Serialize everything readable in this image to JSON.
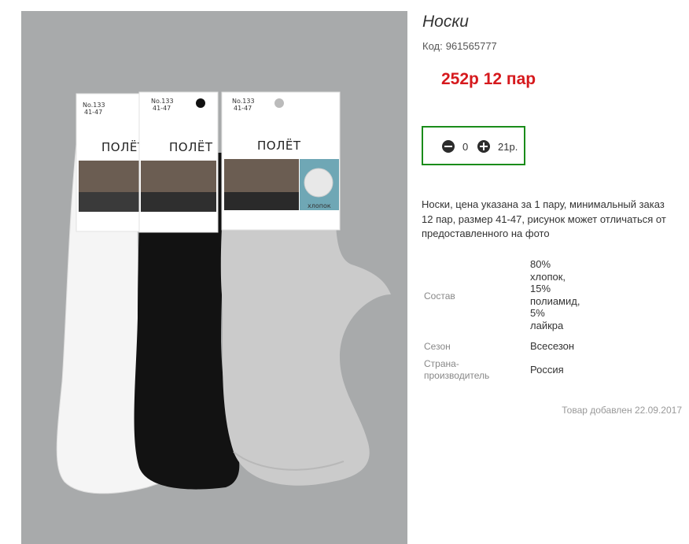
{
  "product": {
    "title": "Носки",
    "code_label": "Код:",
    "code_value": "961565777",
    "price_text": "252р 12 пар",
    "quantity": "0",
    "sum": "21р.",
    "description": "Носки, цена указана за 1 пару, минимальный заказ 12 пар, размер 41-47, рисунок может отличаться от предоставленного на фото",
    "added_text": "Товар добавлен 22.09.2017"
  },
  "properties": [
    {
      "name": "Состав",
      "value_lines": [
        "80%",
        "хлопок,",
        "15%",
        "полиамид,",
        "5%",
        "лайкра"
      ]
    },
    {
      "name": "Сезон",
      "value_lines": [
        "Всесезон"
      ]
    },
    {
      "name_lines": [
        "Страна-",
        "производитель"
      ],
      "value_lines": [
        "Россия"
      ]
    }
  ],
  "photo_labels": {
    "card_number": "No.133",
    "card_size": "41-47",
    "brand": "ПОЛЁТ",
    "cotton_tag": "хлопок"
  },
  "colors": {
    "price": "#d6191d",
    "qty_border": "#1a8c1a",
    "photo_bg": "#a8aaab"
  }
}
